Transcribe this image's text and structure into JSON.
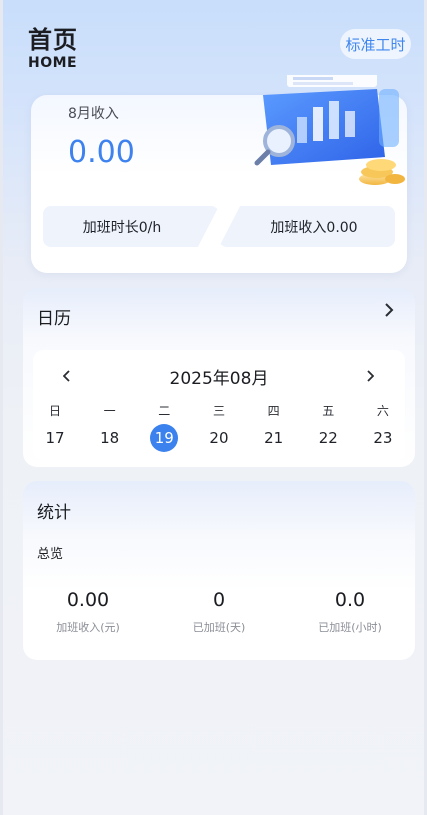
{
  "header": {
    "title": "首页",
    "subtitle": "HOME",
    "std_button": "标准工时"
  },
  "income": {
    "label": "8月收入",
    "value": "0.00",
    "overtime_hours": "加班时长0/h",
    "overtime_income": "加班收入0.00"
  },
  "calendar": {
    "title": "日历",
    "more_icon": "chevron-right-icon",
    "prev_icon": "chevron-left-icon",
    "next_icon": "chevron-right-icon",
    "month": "2025年08月",
    "weekdays": [
      "日",
      "一",
      "二",
      "三",
      "四",
      "五",
      "六"
    ],
    "days": [
      "17",
      "18",
      "19",
      "20",
      "21",
      "22",
      "23"
    ],
    "selected_day": "19",
    "accent_color": "#3b82ee"
  },
  "stats": {
    "title": "统计",
    "subtitle": "总览",
    "items": [
      {
        "value": "0.00",
        "label": "加班收入(元)"
      },
      {
        "value": "0",
        "label": "已加班(天)"
      },
      {
        "value": "0.0",
        "label": "已加班(小时)"
      }
    ]
  }
}
